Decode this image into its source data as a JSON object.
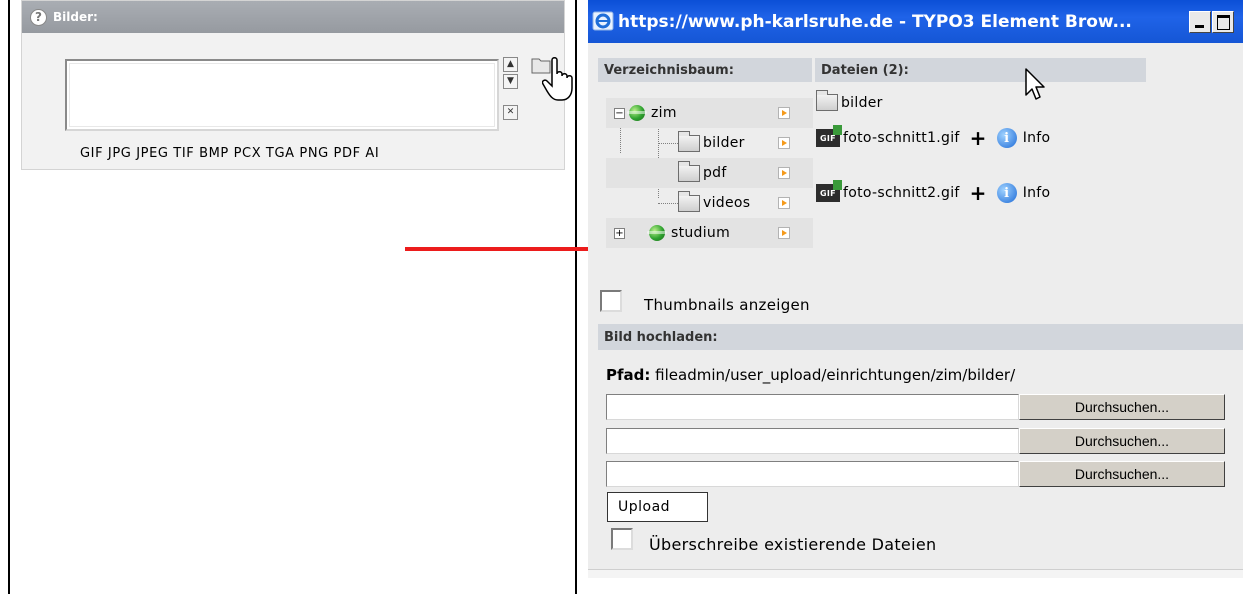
{
  "left_panel": {
    "help_icon": "?",
    "title": "Bilder:",
    "controls": {
      "up": "▲",
      "down": "▼",
      "remove": "✕"
    },
    "allowed_extensions": "GIF JPG JPEG TIF BMP PCX TGA PNG PDF AI"
  },
  "window": {
    "title": "https://www.ph-karlsruhe.de - TYPO3 Element Brow...",
    "directory_tree_label": "Verzeichnisbaum:",
    "files_label": "Dateien (2):",
    "tree": [
      {
        "label": "zim",
        "toggle": "−",
        "type": "globe"
      },
      {
        "label": "bilder",
        "type": "folder"
      },
      {
        "label": "pdf",
        "type": "folder"
      },
      {
        "label": "videos",
        "type": "folder"
      },
      {
        "label": "studium",
        "toggle": "+",
        "type": "globe"
      }
    ],
    "files": {
      "folder": "bilder",
      "items": [
        {
          "icon": "GIF",
          "name": "foto-schnitt1.gif",
          "plus": "+",
          "info_icon": "i",
          "info": "Info"
        },
        {
          "icon": "GIF",
          "name": "foto-schnitt2.gif",
          "plus": "+",
          "info_icon": "i",
          "info": "Info"
        }
      ]
    },
    "thumbnails_label": "Thumbnails anzeigen",
    "upload_section_label": "Bild hochladen:",
    "path_label": "Pfad:",
    "path_value": "fileadmin/user_upload/einrichtungen/zim/bilder/",
    "browse_label": "Durchsuchen...",
    "upload_button": "Upload",
    "overwrite_label": "Überschreibe existierende Dateien"
  },
  "colors": {
    "titlebar": "#1f63e8",
    "section_header": "#d2d6dc",
    "arrow": "#ec1c1c",
    "left_header": "#a0a4aa"
  }
}
